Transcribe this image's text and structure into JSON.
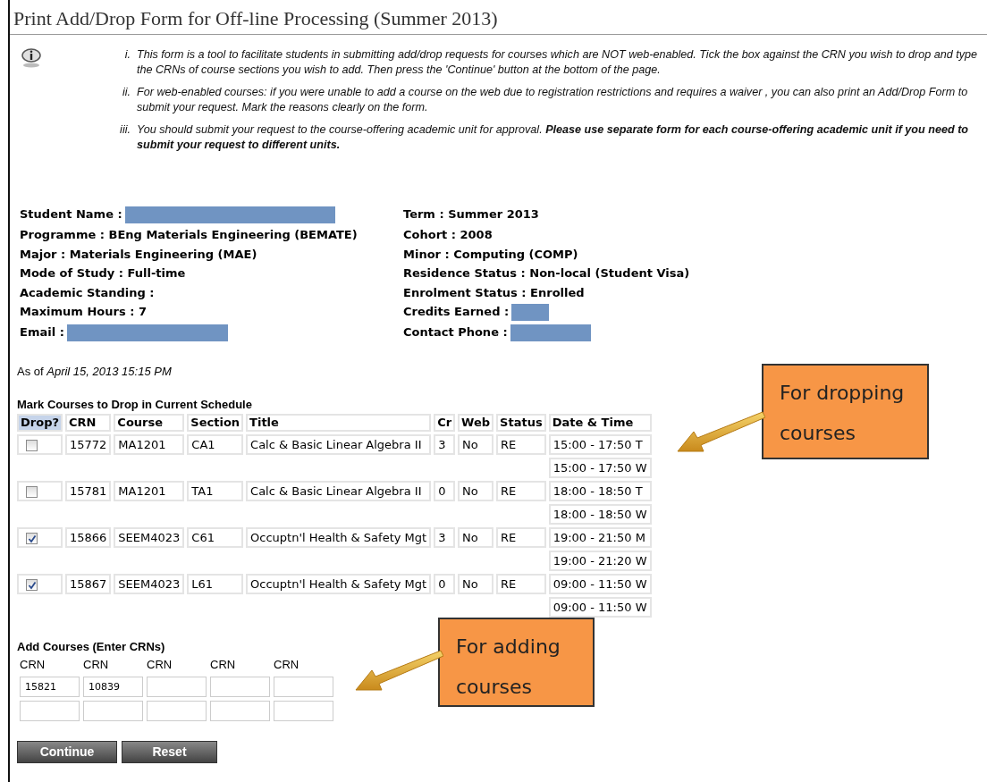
{
  "page_title": "Print Add/Drop Form for Off-line Processing (Summer 2013)",
  "notes": [
    {
      "numeral": "i.",
      "text": "This form is a tool to facilitate students in submitting add/drop requests for courses which are NOT web-enabled. Tick the box against the CRN you wish to drop and type the CRNs of course sections you wish to add. Then press the 'Continue' button at the bottom of the page."
    },
    {
      "numeral": "ii.",
      "text": "For web-enabled courses: if you were unable to add a course on the web due to registration restrictions and requires a waiver , you can also print an Add/Drop Form to submit your request. Mark the reasons clearly on the form."
    },
    {
      "numeral": "iii.",
      "text": "You should submit your request to the course-offering academic unit for approval. **Please use separate form for each course-offering academic unit if you need to submit your request to different units.**"
    }
  ],
  "student_info": [
    {
      "text": "Student Name :",
      "redacted": true
    },
    {
      "text": "Term : Summer 2013"
    },
    {
      "text": "Programme : BEng Materials Engineering (BEMATE)"
    },
    {
      "text": "Cohort : 2008"
    },
    {
      "text": "Major : Materials Engineering (MAE)"
    },
    {
      "text": "Minor : Computing (COMP)"
    },
    {
      "text": "Mode of Study : Full-time"
    },
    {
      "text": "Residence Status : Non-local (Student Visa)"
    },
    {
      "text": "Academic Standing :"
    },
    {
      "text": "Enrolment Status : Enrolled"
    },
    {
      "text": "Maximum Hours : 7"
    },
    {
      "text": "Credits Earned :",
      "redacted": true
    },
    {
      "text": "Email :",
      "redacted": true
    },
    {
      "text": "Contact Phone :",
      "redacted": true
    }
  ],
  "as_of": "As of *April 15, 2013 15:15 PM*",
  "drop_section": {
    "title": "Mark Courses to Drop in Current Schedule",
    "columns": [
      "Drop?",
      "CRN",
      "Course",
      "Section",
      "Title",
      "Cr",
      "Web",
      "Status",
      "Date & Time"
    ],
    "rows": [
      {
        "checked": false,
        "crn": "15772",
        "course": "MA1201",
        "section": "CA1",
        "title": "Calc & Basic Linear Algebra II",
        "cr": "3",
        "web": "No",
        "status": "RE",
        "times": [
          "15:00 - 17:50 T",
          "15:00 - 17:50 W"
        ]
      },
      {
        "checked": false,
        "crn": "15781",
        "course": "MA1201",
        "section": "TA1",
        "title": "Calc & Basic Linear Algebra II",
        "cr": "0",
        "web": "No",
        "status": "RE",
        "times": [
          "18:00 - 18:50 T",
          "18:00 - 18:50 W"
        ]
      },
      {
        "checked": true,
        "crn": "15866",
        "course": "SEEM4023",
        "section": "C61",
        "title": "Occuptn'l Health & Safety Mgt",
        "cr": "3",
        "web": "No",
        "status": "RE",
        "times": [
          "19:00 - 21:50 M",
          "19:00 - 21:20 W"
        ]
      },
      {
        "checked": true,
        "crn": "15867",
        "course": "SEEM4023",
        "section": "L61",
        "title": "Occuptn'l Health & Safety Mgt",
        "cr": "0",
        "web": "No",
        "status": "RE",
        "times": [
          "09:00 - 11:50 W",
          "09:00 - 11:50 W"
        ]
      }
    ]
  },
  "add_section": {
    "title": "Add Courses (Enter CRNs)",
    "columns": [
      "CRN",
      "CRN",
      "CRN",
      "CRN",
      "CRN"
    ],
    "rows": [
      [
        "15821",
        "10839",
        null,
        null,
        null
      ],
      [
        null,
        null,
        null,
        null,
        null
      ]
    ]
  },
  "buttons": [
    "Continue",
    "Reset"
  ],
  "callouts": [
    {
      "text": "For dropping courses"
    },
    {
      "text": "For adding courses"
    }
  ]
}
